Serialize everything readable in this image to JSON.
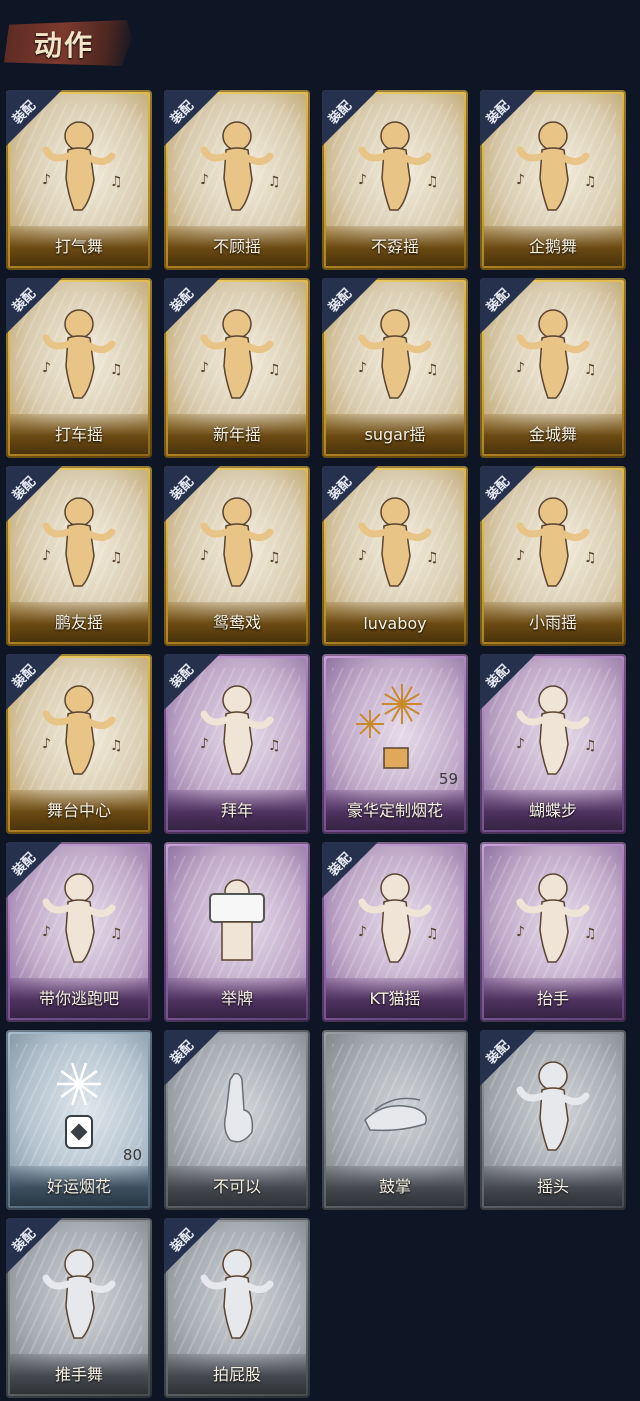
{
  "section": {
    "title": "动作"
  },
  "equip_badge_label": "装配",
  "colors": {
    "gold": "#c89a2b",
    "purple": "#8e63a7",
    "blue": "#6f8799",
    "gray": "#6c7178",
    "background": "#0e1524"
  },
  "emotes": [
    {
      "name": "打气舞",
      "rarity": "gold",
      "equipped": true,
      "icon": "dance-figure-icon"
    },
    {
      "name": "不顾摇",
      "rarity": "gold",
      "equipped": true,
      "icon": "dance-figure-icon"
    },
    {
      "name": "不孬摇",
      "rarity": "gold",
      "equipped": true,
      "icon": "dance-figure-icon"
    },
    {
      "name": "企鹅舞",
      "rarity": "gold",
      "equipped": true,
      "icon": "dance-figure-icon"
    },
    {
      "name": "打车摇",
      "rarity": "gold",
      "equipped": true,
      "icon": "dance-figure-icon"
    },
    {
      "name": "新年摇",
      "rarity": "gold",
      "equipped": true,
      "icon": "dance-figure-icon"
    },
    {
      "name": "sugar摇",
      "rarity": "gold",
      "equipped": true,
      "icon": "dance-figure-icon"
    },
    {
      "name": "金城舞",
      "rarity": "gold",
      "equipped": true,
      "icon": "dance-figure-icon"
    },
    {
      "name": "鹏友摇",
      "rarity": "gold",
      "equipped": true,
      "icon": "dance-figure-icon"
    },
    {
      "name": "鸳鸯戏",
      "rarity": "gold",
      "equipped": true,
      "icon": "dance-figure-icon"
    },
    {
      "name": "luvaboy",
      "rarity": "gold",
      "equipped": true,
      "icon": "dance-figure-icon"
    },
    {
      "name": "小雨摇",
      "rarity": "gold",
      "equipped": true,
      "icon": "dance-figure-icon"
    },
    {
      "name": "舞台中心",
      "rarity": "gold",
      "equipped": true,
      "icon": "dance-figure-icon"
    },
    {
      "name": "拜年",
      "rarity": "purple",
      "equipped": true,
      "icon": "bow-figure-icon"
    },
    {
      "name": "豪华定制烟花",
      "rarity": "purple",
      "equipped": false,
      "icon": "fireworks-box-icon",
      "count": "59"
    },
    {
      "name": "蝴蝶步",
      "rarity": "purple",
      "equipped": true,
      "icon": "dance-figure-icon"
    },
    {
      "name": "带你逃跑吧",
      "rarity": "purple",
      "equipped": true,
      "icon": "dance-figure-icon"
    },
    {
      "name": "举牌",
      "rarity": "purple",
      "equipped": false,
      "icon": "sign-figure-icon"
    },
    {
      "name": "KT猫摇",
      "rarity": "purple",
      "equipped": true,
      "icon": "dance-figure-icon"
    },
    {
      "name": "抬手",
      "rarity": "purple",
      "equipped": false,
      "icon": "raise-hand-figure-icon"
    },
    {
      "name": "好运烟花",
      "rarity": "blue",
      "equipped": false,
      "icon": "fireworks-can-icon",
      "count": "80"
    },
    {
      "name": "不可以",
      "rarity": "gray",
      "equipped": true,
      "icon": "finger-wag-icon"
    },
    {
      "name": "鼓掌",
      "rarity": "gray",
      "equipped": false,
      "icon": "clap-hands-icon"
    },
    {
      "name": "摇头",
      "rarity": "gray",
      "equipped": true,
      "icon": "shake-head-figure-icon"
    },
    {
      "name": "推手舞",
      "rarity": "gray",
      "equipped": true,
      "icon": "push-dance-figure-icon"
    },
    {
      "name": "拍屁股",
      "rarity": "gray",
      "equipped": true,
      "icon": "pat-figure-icon"
    }
  ]
}
